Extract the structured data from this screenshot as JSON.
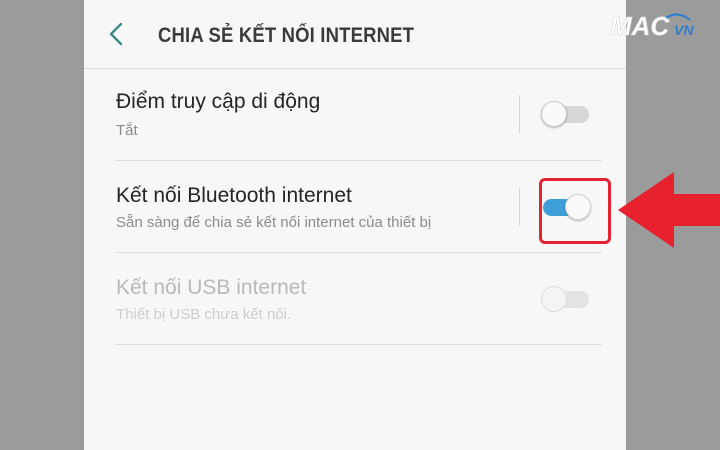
{
  "header": {
    "title": "CHIA SẺ KẾT NỐI INTERNET",
    "back_icon": "chevron-left-icon"
  },
  "settings": [
    {
      "title": "Điểm truy cập di động",
      "subtitle": "Tắt",
      "toggle": "off",
      "enabled": true
    },
    {
      "title": "Kết nối Bluetooth internet",
      "subtitle": "Sẵn sàng để chia sẻ kết nối internet của thiết bị",
      "toggle": "on",
      "enabled": true
    },
    {
      "title": "Kết nối USB internet",
      "subtitle": "Thiết bị USB chưa kết nối.",
      "toggle": "off",
      "enabled": false
    }
  ],
  "annotation": {
    "highlight_color": "#e32431",
    "arrow_icon": "red-arrow-left-icon"
  },
  "watermark": {
    "text": "MAC VN"
  },
  "colors": {
    "accent": "#3f9fd9",
    "back_arrow": "#3c8c8c",
    "background": "#9b9b9b"
  }
}
